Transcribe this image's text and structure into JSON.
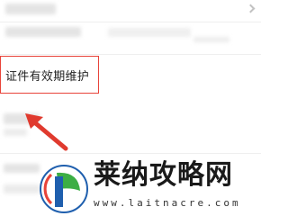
{
  "list": {
    "highlighted_item": {
      "label": "证件有效期维护"
    }
  },
  "annotation": {
    "arrow_color": "#e03a2e",
    "box_color": "#e8443a"
  },
  "watermark": {
    "title": "莱纳攻略网",
    "url": "www.laitnacre.com",
    "logo_colors": {
      "blue": "#1f5fae",
      "green": "#3cae44",
      "red": "#e8443a"
    }
  }
}
